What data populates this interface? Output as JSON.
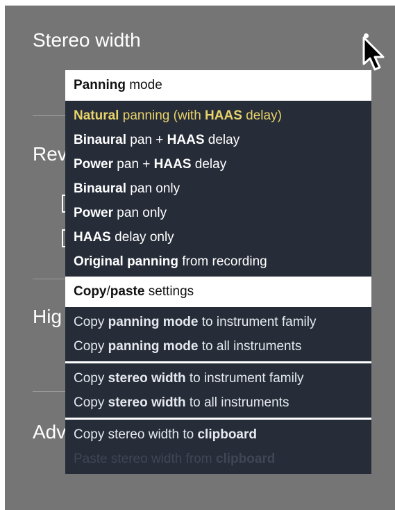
{
  "background": {
    "title": "Stereo width",
    "labels": [
      "Rev",
      "Hig",
      "Adv"
    ]
  },
  "menu": {
    "panning_header": {
      "bold": "Panning",
      "rest": " mode"
    },
    "panning_items": [
      {
        "bold": "Natural",
        "rest": " panning (with ",
        "bold2": "HAAS",
        "rest2": " delay)",
        "selected": true
      },
      {
        "bold": "Binaural",
        "rest": " pan + ",
        "bold2": "HAAS",
        "rest2": " delay"
      },
      {
        "bold": "Power",
        "rest": " pan + ",
        "bold2": "HAAS",
        "rest2": " delay"
      },
      {
        "bold": "Binaural",
        "rest": " pan only"
      },
      {
        "bold": "Power",
        "rest": " pan only"
      },
      {
        "bold": "HAAS",
        "rest": " delay only"
      },
      {
        "bold": "Original panning",
        "rest": " from recording"
      }
    ],
    "copy_header": {
      "bold": "Copy",
      "sep": "/",
      "bold2": "paste",
      "rest": " settings"
    },
    "copy_panning": [
      {
        "pre": "Copy ",
        "bold": "panning mode",
        "rest": " to instrument family"
      },
      {
        "pre": "Copy ",
        "bold": "panning mode",
        "rest": " to all instruments"
      }
    ],
    "copy_width": [
      {
        "pre": "Copy ",
        "bold": "stereo width",
        "rest": " to instrument family"
      },
      {
        "pre": "Copy ",
        "bold": "stereo width",
        "rest": " to all instruments"
      }
    ],
    "clipboard": [
      {
        "pre": "Copy stereo width to ",
        "bold": "clipboard",
        "disabled": false
      },
      {
        "pre": "Paste stereo width from ",
        "bold": "clipboard",
        "disabled": true
      }
    ]
  },
  "colors": {
    "panel": "#757575",
    "menu_bg": "#262c38",
    "selected": "#e8d36a",
    "disabled": "#3f4756"
  }
}
